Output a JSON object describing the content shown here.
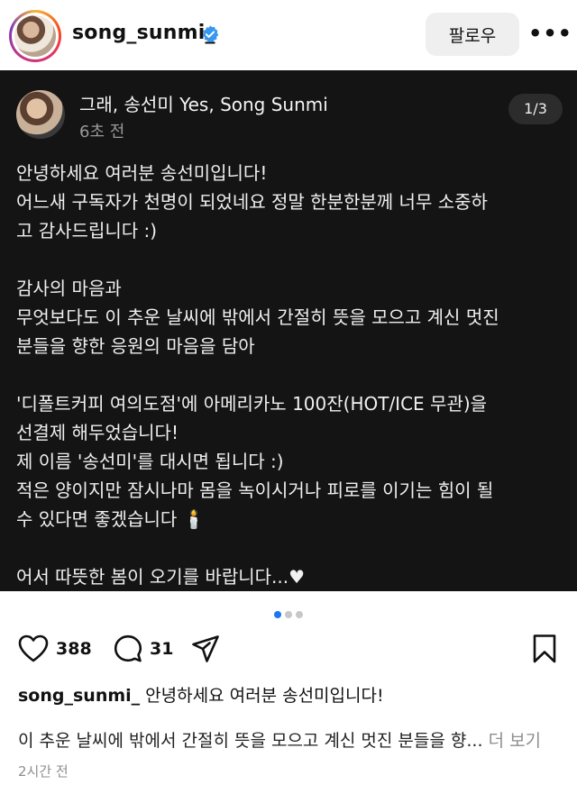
{
  "header": {
    "username": "song_sunmi_",
    "follow_label": "팔로우",
    "more_label": "•••"
  },
  "post": {
    "author_name": "그래, 송선미  Yes, Song Sunmi",
    "time": "6초 전",
    "page_indicator": "1/3",
    "body": "안녕하세요 여러분 송선미입니다!\n어느새 구독자가 천명이 되었네요 정말 한분한분께 너무 소중하\n고 감사드립니다 :)\n\n감사의 마음과\n무엇보다도 이 추운 날씨에 밖에서 간절히 뜻을 모으고 계신 멋진\n분들을 향한 응원의 마음을 담아\n\n'디폴트커피 여의도점'에 아메리카노 100잔(HOT/ICE 무관)을\n선결제 해두었습니다!\n제 이름 '송선미'를 대시면 됩니다 :)\n적은 양이지만 잠시나마 몸을 녹이시거나 피로를 이기는 힘이 될\n수 있다면 좋겠습니다 🕯️\n\n어서 따뜻한 봄이 오기를 바랍니다...♥"
  },
  "carousel": {
    "current": 1,
    "total": 3
  },
  "actions": {
    "likes": "388",
    "comments": "31"
  },
  "caption": {
    "username": "song_sunmi_",
    "first_line": "안녕하세요 여러분 송선미입니다!",
    "second_line": "이 추운 날씨에 밖에서 간절히 뜻을 모으고 계신 멋진 분들을 향...",
    "more_label": "더 보기",
    "timestamp": "2시간 전"
  },
  "colors": {
    "accent_blue": "#1877f2",
    "verified_blue": "#3897f0",
    "post_background": "#141414"
  },
  "icons": [
    "verified-badge-icon",
    "heart-icon",
    "comment-icon",
    "share-icon",
    "bookmark-icon",
    "more-icon"
  ]
}
